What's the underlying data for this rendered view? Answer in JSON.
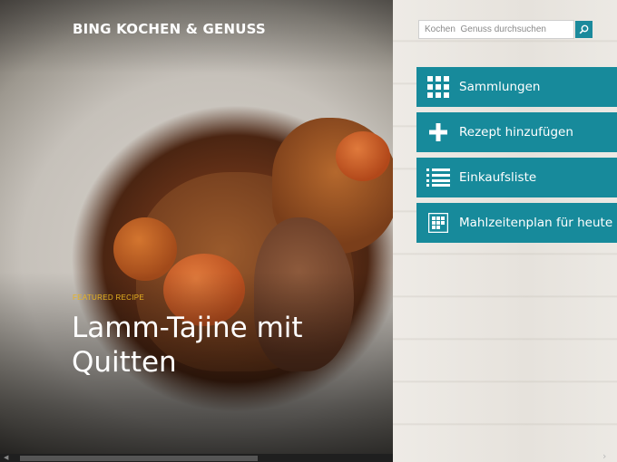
{
  "app": {
    "title": "BING KOCHEN & GENUSS"
  },
  "hero": {
    "featured_label": "FEATURED RECIPE",
    "recipe_title": "Lamm-Tajine mit Quitten"
  },
  "search": {
    "placeholder": "Kochen  Genuss durchsuchen",
    "icon": "search-icon"
  },
  "menu": [
    {
      "label": "Sammlungen",
      "icon": "grid-icon"
    },
    {
      "label": "Rezept hinzufügen",
      "icon": "plus-icon"
    },
    {
      "label": "Einkaufsliste",
      "icon": "list-icon"
    },
    {
      "label": "Mahlzeitenplan für heute",
      "icon": "calendar-grid-icon"
    }
  ],
  "colors": {
    "accent": "#178a9b",
    "featured": "#e8b320"
  }
}
